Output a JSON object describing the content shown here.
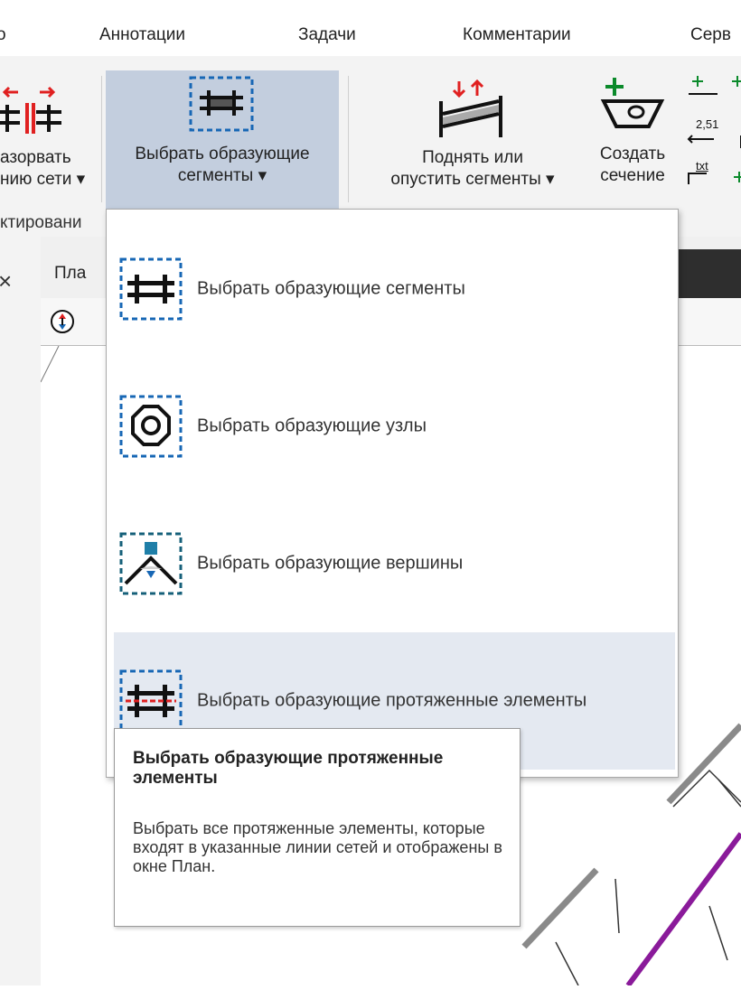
{
  "menubar": {
    "items": [
      "о",
      "Аннотации",
      "Задачи",
      "Комментарии",
      "Серв"
    ]
  },
  "ribbon": {
    "buttons": [
      {
        "line1": "азорвать",
        "line2": "нию сети ▾"
      },
      {
        "line1": "Выбрать образующие",
        "line2": "сегменты ▾"
      },
      {
        "line1": "Поднять или",
        "line2": "опустить сегменты ▾"
      },
      {
        "line1": "Создать",
        "line2": "сечение"
      }
    ],
    "group_label": "ктировани",
    "small_labels": [
      "2,51",
      "txt"
    ]
  },
  "left_panel": {
    "close_glyph": "×"
  },
  "document": {
    "tab_label": "Пла"
  },
  "dropdown": {
    "items": [
      {
        "label": "Выбрать образующие сегменты"
      },
      {
        "label": "Выбрать образующие узлы"
      },
      {
        "label": "Выбрать образующие вершины"
      },
      {
        "label": "Выбрать образующие протяженные элементы"
      }
    ]
  },
  "tooltip": {
    "title": "Выбрать образующие протяженные элементы",
    "body": "Выбрать все протяженные элементы, которые входят в указанные линии сетей и отображены в окне План."
  },
  "colors": {
    "accent_blue": "#1767b5",
    "teal_dash": "#16607a",
    "red": "#e02020",
    "green": "#0b8a2b",
    "purple": "#8a1a9a",
    "selected_bg": "#c3cede",
    "hover_bg": "#e4e9f1"
  }
}
